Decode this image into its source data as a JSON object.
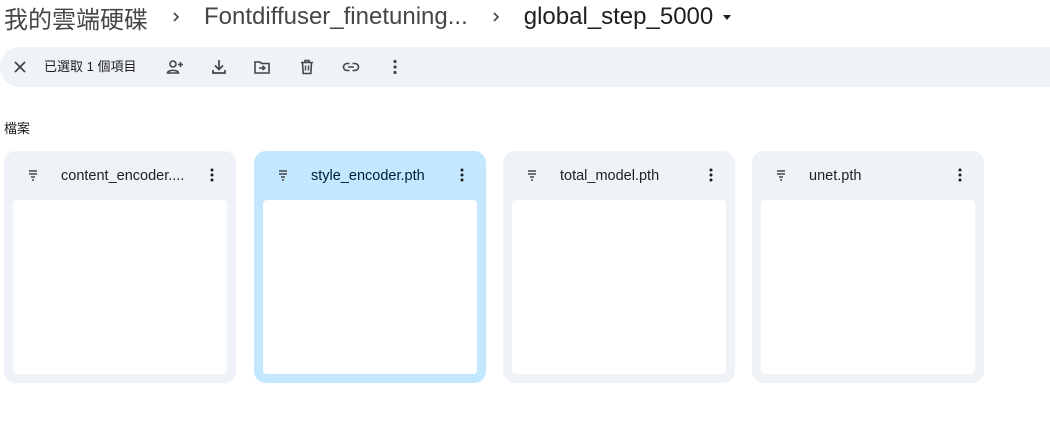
{
  "breadcrumb": {
    "root": "我的雲端硬碟",
    "middle": "Fontdiffuser_finetuning...",
    "current": "global_step_5000"
  },
  "toolbar": {
    "selection_label": "已選取 1 個項目"
  },
  "section": {
    "files_label": "檔案"
  },
  "files": [
    {
      "name": "content_encoder...."
    },
    {
      "name": "style_encoder.pth",
      "selected": true
    },
    {
      "name": "total_model.pth"
    },
    {
      "name": "unet.pth"
    }
  ],
  "colors": {
    "toolbar_bg": "#eff2f6",
    "card_bg": "#eff2f6",
    "selected_card_bg": "#c2e7ff",
    "icon_color": "#444746"
  },
  "icons": {
    "toolbar": [
      "close-icon",
      "share-person-add-icon",
      "download-icon",
      "move-to-folder-icon",
      "trash-icon",
      "link-icon",
      "more-vert-icon"
    ],
    "card": [
      "file-lines-icon",
      "more-vert-icon"
    ]
  }
}
